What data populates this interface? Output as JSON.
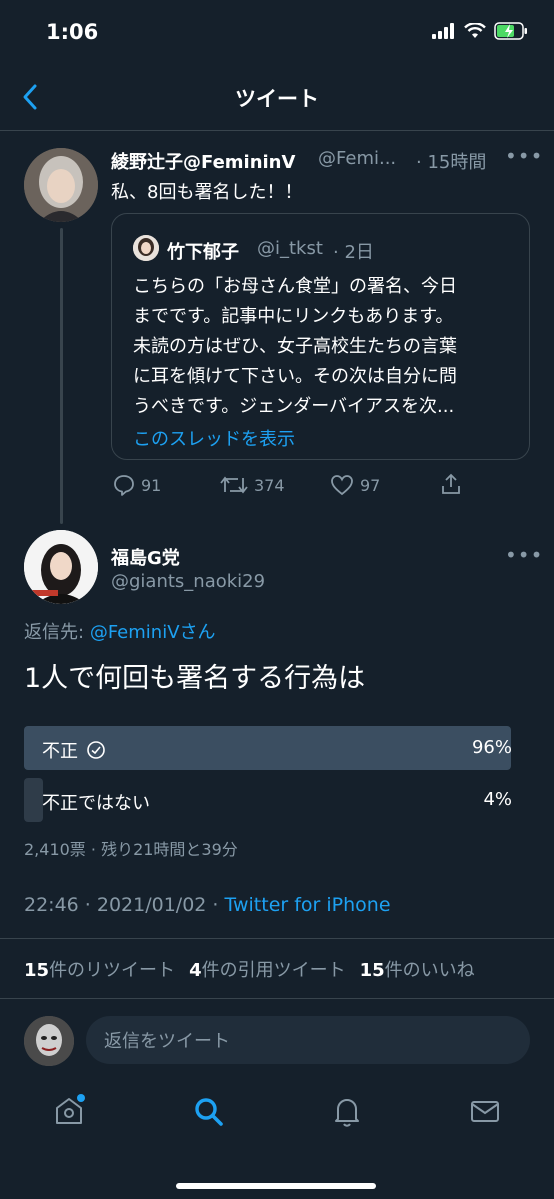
{
  "status_bar": {
    "time": "1:06"
  },
  "header": {
    "title": "ツイート"
  },
  "tweet1": {
    "name": "綾野辻子@FemininV",
    "handle": "@Femi...",
    "time": "· 15時間",
    "text": "私、8回も署名した！！",
    "quote": {
      "name": "竹下郁子",
      "handle": "@i_tkst",
      "time": "· 2日",
      "lines": [
        "こちらの「お母さん食堂」の署名、今日",
        "までです。記事中にリンクもあります。",
        "未読の方はぜひ、女子高校生たちの言葉",
        "に耳を傾けて下さい。その次は自分に問",
        "うべきです。ジェンダーバイアスを次..."
      ],
      "show_thread": "このスレッドを表示"
    },
    "actions": {
      "replies": "91",
      "retweets": "374",
      "likes": "97"
    }
  },
  "tweet2": {
    "name": "福島G党",
    "handle": "@giants_naoki29",
    "reply_to_label": "返信先:",
    "reply_to_user": "@FeminiVさん",
    "text": "1人で何回も署名する行為は",
    "poll": {
      "options": [
        {
          "label": "不正",
          "percent": "96%",
          "fraction": 0.96,
          "winner": true
        },
        {
          "label": "不正ではない",
          "percent": "4%",
          "fraction": 0.04,
          "winner": false
        }
      ],
      "meta": "2,410票 · 残り21時間と39分"
    },
    "timestamp": "22:46 · 2021/01/02 · ",
    "client": "Twitter for iPhone",
    "stats": {
      "retweets_count": "15",
      "retweets_label": "件のリツイート",
      "quotes_count": "4",
      "quotes_label": "件の引用ツイート",
      "likes_count": "15",
      "likes_label": "件のいいね"
    }
  },
  "reply": {
    "placeholder": "返信をツイート"
  },
  "colors": {
    "background": "#15202b",
    "accent": "#1da1f2",
    "poll_winner": "#3b4e61",
    "poll_other": "#2f3c49"
  }
}
